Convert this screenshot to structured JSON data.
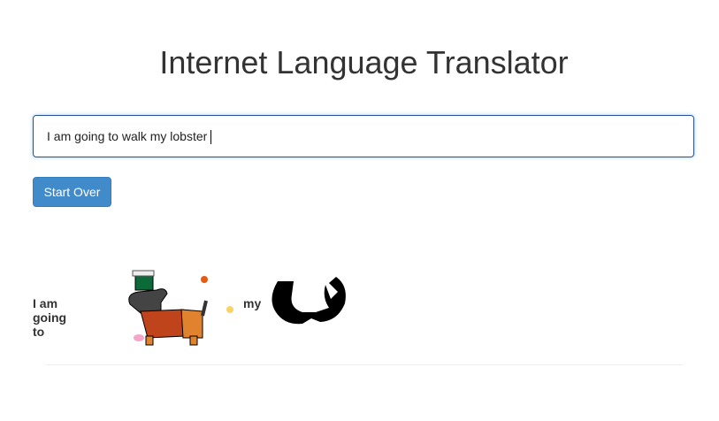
{
  "header": {
    "title": "Internet Language Translator"
  },
  "input": {
    "value": "I am going to walk my lobster"
  },
  "buttons": {
    "start_over": "Start Over"
  },
  "output": {
    "segments": [
      {
        "type": "text",
        "text": "I am going to"
      },
      {
        "type": "image",
        "icon": "walking-dog-icon"
      },
      {
        "type": "text",
        "text": "my"
      },
      {
        "type": "image",
        "icon": "lobster-icon"
      }
    ]
  }
}
